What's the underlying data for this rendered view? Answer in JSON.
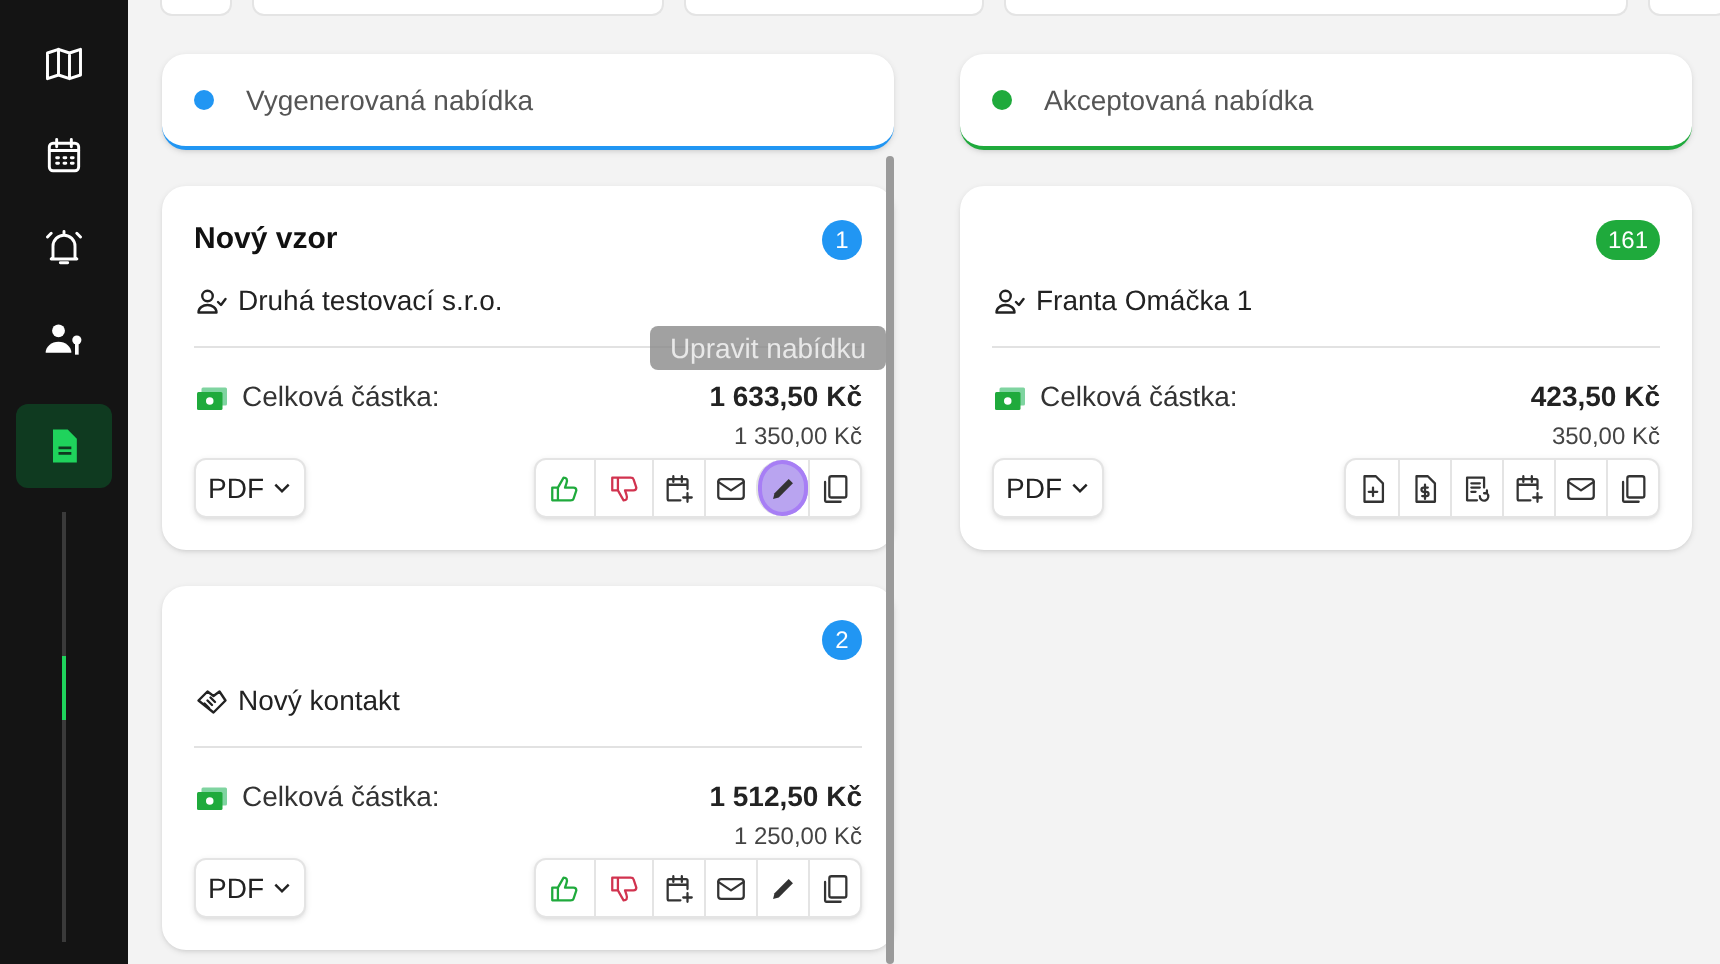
{
  "sidebar": {
    "items": [
      {
        "kind": "map",
        "selected": false
      },
      {
        "kind": "calendar",
        "selected": false
      },
      {
        "kind": "bell",
        "selected": false
      },
      {
        "kind": "user-key",
        "selected": false
      },
      {
        "kind": "document",
        "selected": true
      }
    ]
  },
  "columns": [
    {
      "title": "Vygenerovaná nabídka",
      "color": "#2196f3",
      "cards": [
        {
          "title": "Nový vzor",
          "number": "1",
          "contact": {
            "kind": "person",
            "name": "Druhá testovací s.r.o."
          },
          "total_label": "Celková částka:",
          "total": "1 633,50 Kč",
          "subtotal": "1 350,00 Kč",
          "format": "PDF",
          "tooltip": "Upravit nabídku",
          "actions": [
            {
              "kind": "like",
              "highlighted": false
            },
            {
              "kind": "dislike",
              "highlighted": false
            },
            {
              "kind": "calendar-add",
              "highlighted": false
            },
            {
              "kind": "mail",
              "highlighted": false
            },
            {
              "kind": "edit",
              "highlighted": true
            },
            {
              "kind": "copy",
              "highlighted": false
            }
          ]
        },
        {
          "number": "2",
          "contact": {
            "kind": "handshake",
            "name": "Nový kontakt"
          },
          "total_label": "Celková částka:",
          "total": "1 512,50 Kč",
          "subtotal": "1 250,00 Kč",
          "format": "PDF",
          "actions": [
            {
              "kind": "like",
              "highlighted": false
            },
            {
              "kind": "dislike",
              "highlighted": false
            },
            {
              "kind": "calendar-add",
              "highlighted": false
            },
            {
              "kind": "mail",
              "highlighted": false
            },
            {
              "kind": "edit",
              "highlighted": false
            },
            {
              "kind": "copy",
              "highlighted": false
            }
          ]
        }
      ]
    },
    {
      "title": "Akceptovaná nabídka",
      "color": "#1faa3c",
      "cards": [
        {
          "number": "161",
          "contact": {
            "kind": "person",
            "name": "Franta Omáčka 1"
          },
          "total_label": "Celková částka:",
          "total": "423,50 Kč",
          "subtotal": "350,00 Kč",
          "format": "PDF",
          "actions": [
            {
              "kind": "file-add",
              "highlighted": false
            },
            {
              "kind": "invoice",
              "highlighted": false
            },
            {
              "kind": "file-refresh",
              "highlighted": false
            },
            {
              "kind": "calendar-add",
              "highlighted": false
            },
            {
              "kind": "mail",
              "highlighted": false
            },
            {
              "kind": "copy",
              "highlighted": false
            }
          ]
        }
      ]
    }
  ]
}
